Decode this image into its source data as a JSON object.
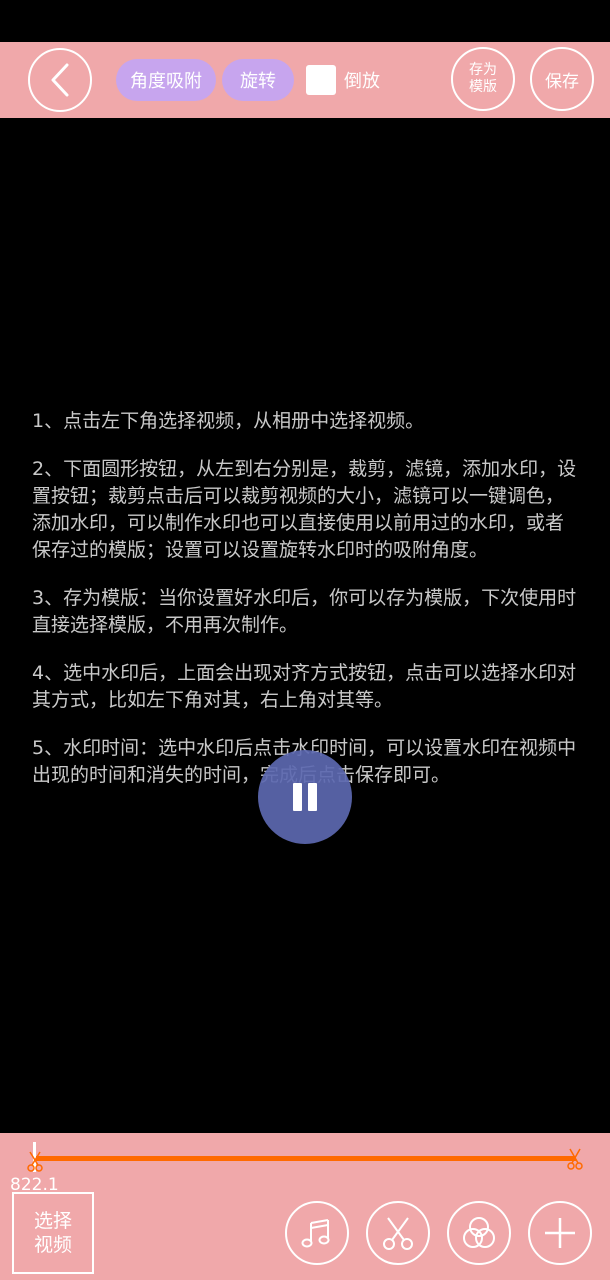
{
  "toolbar": {
    "angle_snap_label": "角度吸附",
    "rotate_label": "旋转",
    "reverse_label": "倒放",
    "save_template_line1": "存为",
    "save_template_line2": "模版",
    "save_label": "保存"
  },
  "instructions": [
    "1、点击左下角选择视频，从相册中选择视频。",
    "2、下面圆形按钮，从左到右分别是，裁剪，滤镜，添加水印，设置按钮；裁剪点击后可以裁剪视频的大小，滤镜可以一键调色，添加水印，可以制作水印也可以直接使用以前用过的水印，或者保存过的模版；设置可以设置旋转水印时的吸附角度。",
    "3、存为模版：当你设置好水印后，你可以存为模版，下次使用时直接选择模版，不用再次制作。",
    "4、选中水印后，上面会出现对齐方式按钮，点击可以选择水印对其方式，比如左下角对其，右上角对其等。",
    "5、水印时间：选中水印后点击水印时间，可以设置水印在视频中出现的时间和消失的时间，完成后点击保存即可。"
  ],
  "timeline": {
    "time_value": "822.1"
  },
  "bottom": {
    "select_video_line1": "选择",
    "select_video_line2": "视频"
  },
  "colors": {
    "bar_bg": "#f0a8aa",
    "pill_bg": "#c7a5ee",
    "timeline": "#ff6a00",
    "play_button": "#5c68b0"
  },
  "icons": [
    "back-arrow-icon",
    "pause-icon",
    "scissors-icon",
    "music-note-icon",
    "filter-circles-icon",
    "plus-icon"
  ]
}
